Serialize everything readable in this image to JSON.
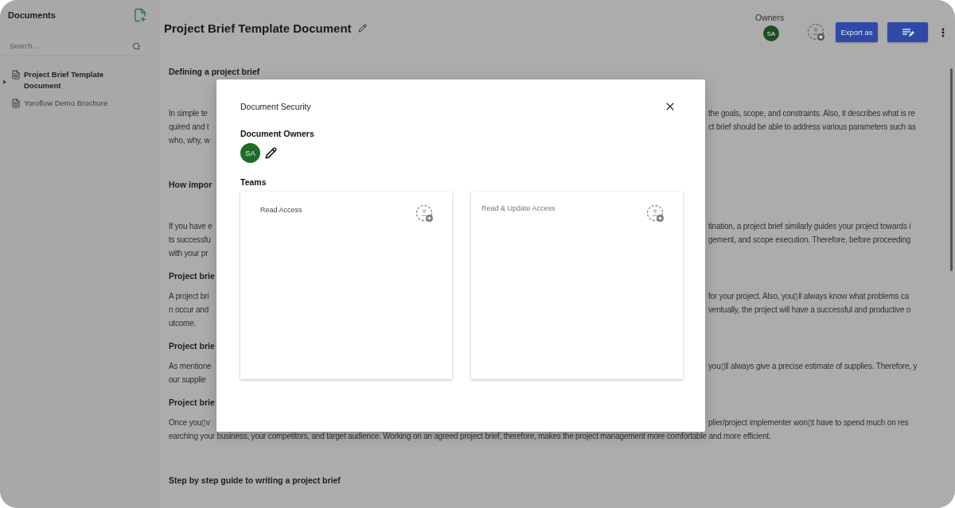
{
  "sidebar": {
    "title": "Documents",
    "search": {
      "placeholder": "Search..."
    },
    "tree": [
      {
        "label": "Project Brief Template Document",
        "selected": true,
        "expandable": true
      },
      {
        "label": "Yoroflow Demo Brochure",
        "selected": false,
        "expandable": false
      }
    ]
  },
  "header": {
    "title": "Project Brief Template Document",
    "owners_label": "Owners",
    "owners": [
      {
        "initials": "SA",
        "color": "#1f4d1f"
      }
    ],
    "buttons": [
      {
        "kind": "text",
        "label": "Export as"
      },
      {
        "kind": "edit"
      }
    ]
  },
  "document": [
    {
      "kind": "heading",
      "text": "Defining a project brief"
    },
    {
      "kind": "blank"
    },
    {
      "kind": "paragraph",
      "lines": [
        {
          "left": "In simple te",
          "right": "the goals, scope, and constraints. Also, it describes what is re"
        },
        {
          "left": "quired and t",
          "right": "ct brief should be able to address various parameters such as"
        },
        {
          "left": "who, why, w"
        }
      ]
    },
    {
      "kind": "blank"
    },
    {
      "kind": "heading",
      "text": "How impor"
    },
    {
      "kind": "blank"
    },
    {
      "kind": "paragraph",
      "lines": [
        {
          "left": "If you have e",
          "right": "tination, a project brief similarly guides your project towards i"
        },
        {
          "left": "ts successfu",
          "right": "gement, and scope execution. Therefore, before proceeding"
        },
        {
          "left": "with your pr"
        }
      ]
    },
    {
      "kind": "heading",
      "text": "Project brie"
    },
    {
      "kind": "paragraph",
      "lines": [
        {
          "left": "A project bri",
          "right": "for your project. Also, you▯ll always know what problems ca"
        },
        {
          "left": "n occur and",
          "right": "ventually, the project will have a successful and productive o"
        },
        {
          "left": "utcome."
        }
      ]
    },
    {
      "kind": "heading",
      "text": "Project brie"
    },
    {
      "kind": "paragraph",
      "lines": [
        {
          "left": "As mentione",
          "right": "you▯ll always give a precise estimate of supplies. Therefore, y"
        },
        {
          "left": "our supplie"
        }
      ]
    },
    {
      "kind": "heading",
      "text": "Project brie"
    },
    {
      "kind": "paragraph",
      "lines": [
        {
          "left": "Once you▯v",
          "right": "plier/project implementer won▯t have to spend much on res"
        },
        {
          "left": "earching your business, your competitors, and target audience. Working on an agreed project brief, therefore, makes the project management more comfortable and more efficient."
        }
      ]
    },
    {
      "kind": "blank"
    },
    {
      "kind": "heading",
      "text": "Step by step guide to writing a project brief"
    }
  ],
  "dialog": {
    "title": "Document Security",
    "owners_heading": "Document Owners",
    "owners": [
      {
        "initials": "SA",
        "color": "#1e6b2a"
      }
    ],
    "teams_heading": "Teams",
    "teams": [
      {
        "label": "Read Access",
        "muted": false
      },
      {
        "label": "Read & Update Access",
        "muted": true
      }
    ]
  }
}
